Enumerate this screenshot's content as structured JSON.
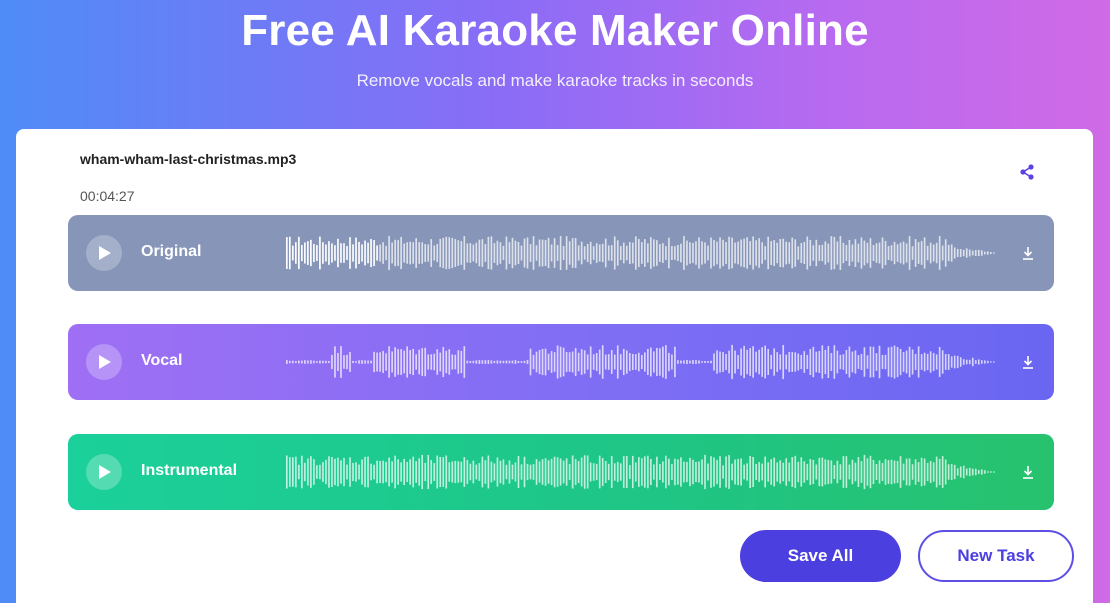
{
  "hero": {
    "title": "Free AI Karaoke Maker Online",
    "subtitle": "Remove vocals and make karaoke tracks in seconds"
  },
  "file": {
    "name": "wham-wham-last-christmas.mp3",
    "duration": "00:04:27"
  },
  "icons": {
    "share": "share-icon",
    "play": "play-icon",
    "download": "download-icon"
  },
  "tracks": [
    {
      "label": "Original",
      "color": "#8695b8"
    },
    {
      "label": "Vocal",
      "color": "#7e6ef4"
    },
    {
      "label": "Instrumental",
      "color": "#1fc585"
    }
  ],
  "actions": {
    "save_all": "Save All",
    "new_task": "New Task"
  },
  "colors": {
    "accent": "#4b3fe0",
    "share_icon": "#5b45e0"
  }
}
